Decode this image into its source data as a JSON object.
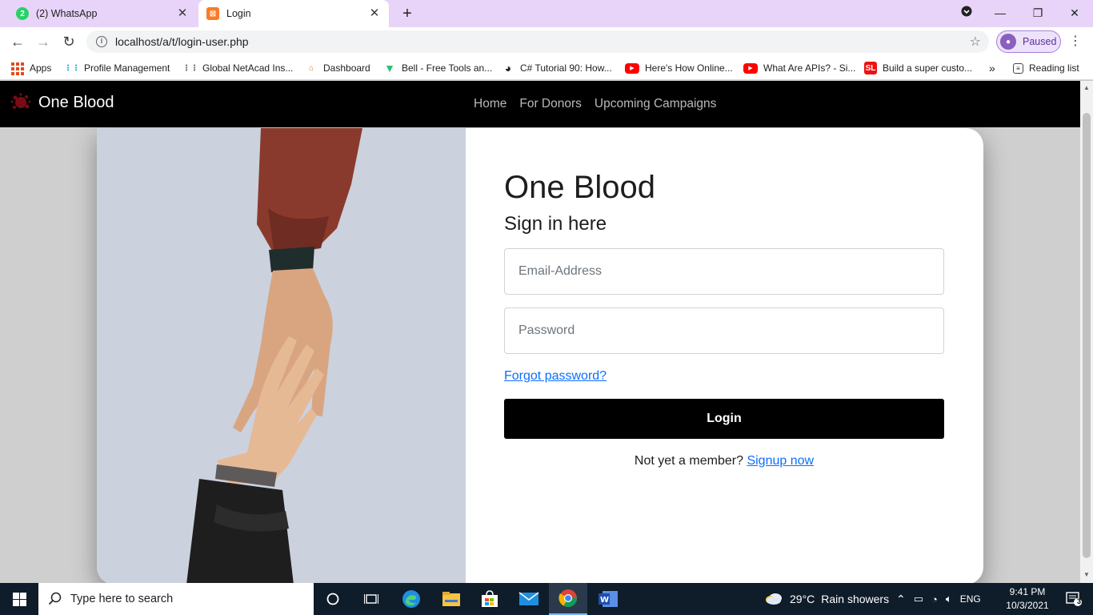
{
  "browser": {
    "tabs": [
      {
        "title": "(2) WhatsApp",
        "badge": "2",
        "active": false
      },
      {
        "title": "Login",
        "active": true
      }
    ],
    "url": "localhost/a/t/login-user.php",
    "profile_label": "Paused",
    "bookmarks": [
      {
        "label": "Apps"
      },
      {
        "label": "Profile Management"
      },
      {
        "label": "Global NetAcad Ins..."
      },
      {
        "label": "Dashboard"
      },
      {
        "label": "Bell - Free Tools an..."
      },
      {
        "label": "C# Tutorial 90: How..."
      },
      {
        "label": "Here's How Online..."
      },
      {
        "label": "What Are APIs? - Si..."
      },
      {
        "label": "Build a super custo..."
      },
      {
        "label": "Reading list"
      }
    ],
    "bookmark_overflow": "»"
  },
  "site": {
    "brand": "One Blood",
    "nav": [
      {
        "label": "Home"
      },
      {
        "label": "For Donors"
      },
      {
        "label": "Upcoming Campaigns"
      }
    ]
  },
  "login": {
    "title": "One Blood",
    "subtitle": "Sign in here",
    "email_placeholder": "Email-Address",
    "email_value": "",
    "password_placeholder": "Password",
    "password_value": "",
    "forgot_label": "Forgot password?",
    "button_label": "Login",
    "signup_prompt": "Not yet a member?",
    "signup_link": "Signup now"
  },
  "taskbar": {
    "search_placeholder": "Type here to search",
    "weather_temp": "29°C",
    "weather_desc": "Rain showers",
    "language": "ENG",
    "time": "9:41 PM",
    "date": "10/3/2021",
    "notification_count": "3"
  },
  "colors": {
    "tabstrip": "#e8d4f8",
    "site_nav": "#000000",
    "link": "#0d6efd",
    "button": "#000000"
  }
}
